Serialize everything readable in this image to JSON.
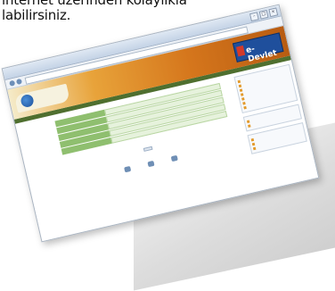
{
  "caption": {
    "line1": "internet üzerinden kolaylıkla",
    "line2": "labilirsiniz."
  },
  "browser": {
    "title": "",
    "url": ""
  },
  "site": {
    "name": "",
    "brand_top": "",
    "brand_main": "e-Devlet"
  },
  "form": {
    "title": "",
    "fields": [
      "",
      "",
      "",
      "",
      ""
    ],
    "submit_label": "",
    "bullets": [
      "",
      "",
      ""
    ],
    "actions": [
      "",
      "",
      ""
    ]
  },
  "sidebar": {
    "boxes": [
      {
        "title": "",
        "items": [
          "",
          "",
          "",
          "",
          "",
          "",
          ""
        ]
      },
      {
        "title": "",
        "items": [
          "",
          ""
        ]
      },
      {
        "title": "",
        "items": [
          "",
          "",
          ""
        ]
      }
    ]
  },
  "colors": {
    "header_orange": "#d5761c",
    "brand_blue": "#1f4f9c",
    "form_green": "#8fbf6f"
  }
}
